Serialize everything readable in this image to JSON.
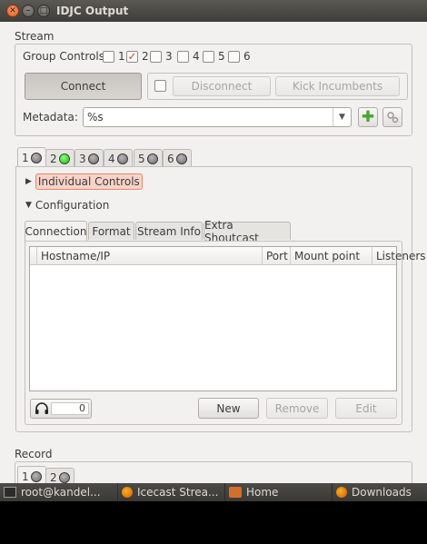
{
  "window": {
    "title": "IDJC Output"
  },
  "stream": {
    "section_label": "Stream",
    "group_controls_label": "Group Controls",
    "group_numbers": [
      "1",
      "2",
      "3",
      "4",
      "5",
      "6"
    ],
    "group_checked": [
      false,
      true,
      false,
      false,
      false,
      false
    ],
    "connect_label": "Connect",
    "disconnect_label": "Disconnect",
    "kick_label": "Kick Incumbents",
    "metadata_label": "Metadata:",
    "metadata_value": "%s",
    "stream_tabs": [
      "1",
      "2",
      "3",
      "4",
      "5",
      "6"
    ],
    "stream_tab_green_index": 1,
    "individual_controls_label": "Individual Controls",
    "configuration_label": "Configuration",
    "config_tabs": [
      "Connection",
      "Format",
      "Stream Info",
      "Extra Shoutcast"
    ],
    "table_headers": [
      "Hostname/IP",
      "Port",
      "Mount point",
      "Listeners"
    ],
    "listener_count": "0",
    "new_label": "New",
    "remove_label": "Remove",
    "edit_label": "Edit"
  },
  "record": {
    "section_label": "Record",
    "tabs": [
      "1",
      "2"
    ]
  },
  "taskbar": {
    "items": [
      {
        "label": "root@kandel...",
        "icon": "terminal-icon"
      },
      {
        "label": "Icecast Strea...",
        "icon": "firefox-icon"
      },
      {
        "label": "Home",
        "icon": "folder-home-icon"
      },
      {
        "label": "Downloads",
        "icon": "firefox-icon"
      }
    ]
  },
  "colors": {
    "accent_checked": "#d2492a",
    "led_green": "#1cb61a",
    "highlight": "#f7d3c9"
  }
}
